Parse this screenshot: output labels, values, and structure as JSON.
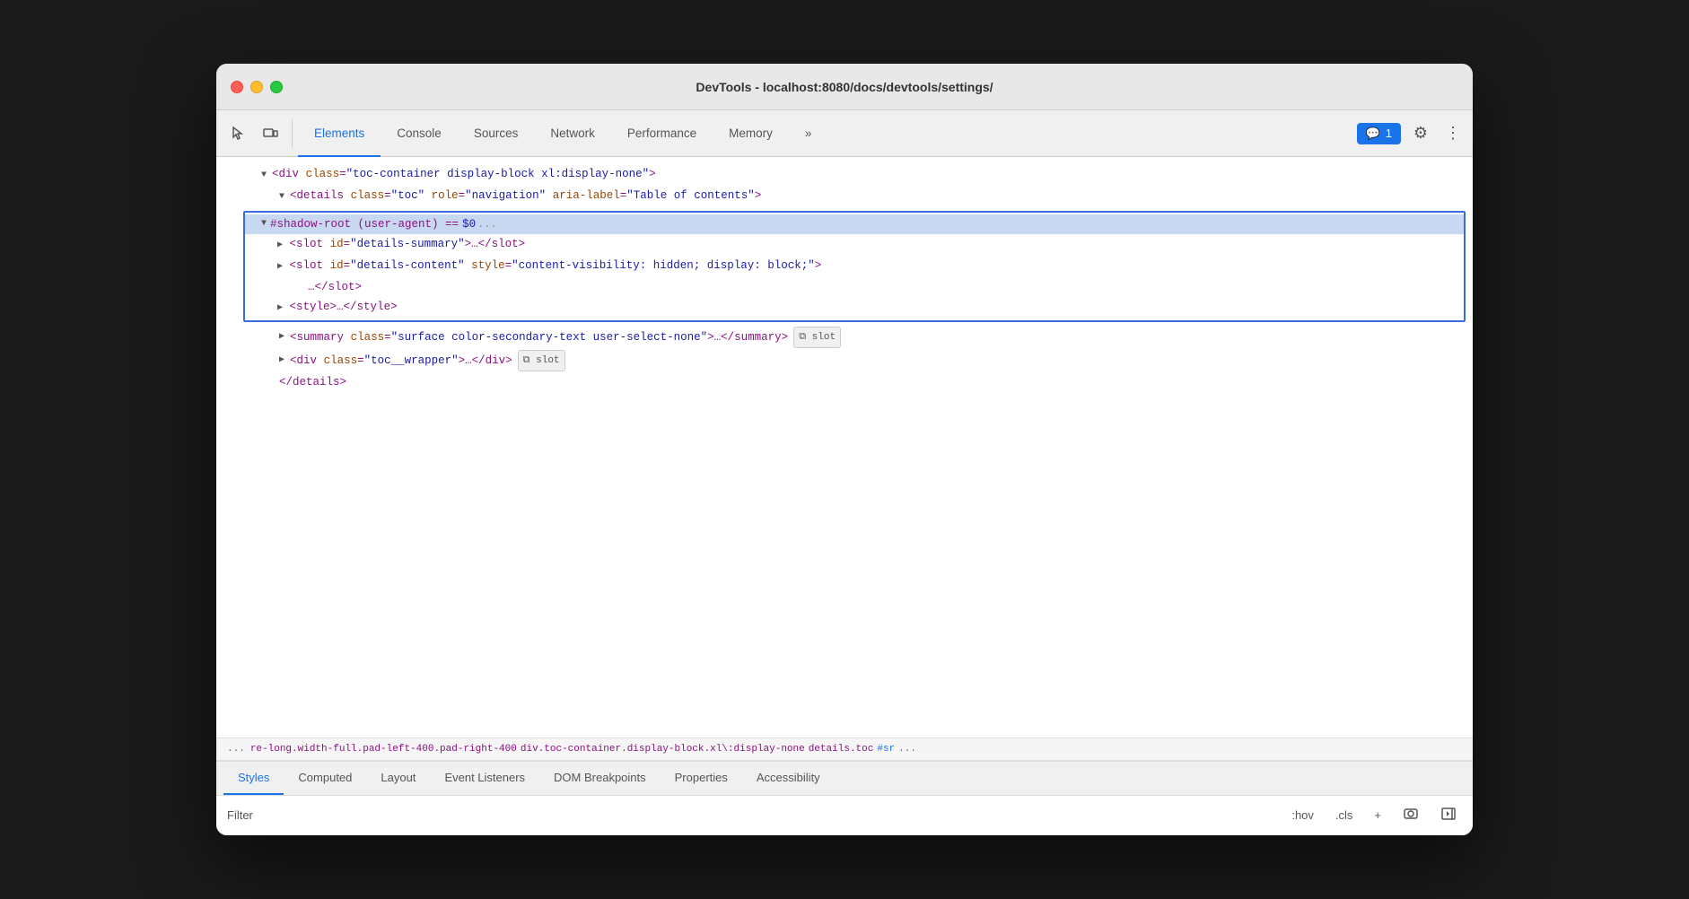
{
  "window": {
    "title": "DevTools - localhost:8080/docs/devtools/settings/"
  },
  "toolbar": {
    "tabs": [
      {
        "label": "Elements",
        "active": true
      },
      {
        "label": "Console",
        "active": false
      },
      {
        "label": "Sources",
        "active": false
      },
      {
        "label": "Network",
        "active": false
      },
      {
        "label": "Performance",
        "active": false
      },
      {
        "label": "Memory",
        "active": false
      },
      {
        "label": "»",
        "active": false
      }
    ],
    "msg_count": "1",
    "msg_icon": "💬"
  },
  "dom": {
    "line1": "▼ <div class=\"toc-container display-block xl:display-none\">",
    "line2": "▼ <details class=\"toc\" role=\"navigation\" aria-label=\"Table of contents\">",
    "shadow_root_label": "▼ #shadow-root (user-agent) == $0",
    "shadow_line1": "▶ <slot id=\"details-summary\">…</slot>",
    "shadow_line2": "▶ <slot id=\"details-content\" style=\"content-visibility: hidden; display: block;\">",
    "shadow_ellipsis": "…</slot>",
    "shadow_line3": "▶ <style>…</style>",
    "line3": "▶ <summary class=\"surface color-secondary-text user-select-none\">…</summary>",
    "slot_badge1": "⧉ slot",
    "line4": "▶ <div class=\"toc__wrapper\">…</div>",
    "slot_badge2": "⧉ slot",
    "line5": "</details>"
  },
  "breadcrumb": {
    "dots": "...",
    "items": [
      {
        "text": "re-long.width-full.pad-left-400.pad-right-400",
        "type": "class"
      },
      {
        "text": "div.toc-container.display-block.xl\\:display-none",
        "type": "element"
      },
      {
        "text": "details.toc",
        "type": "element"
      },
      {
        "text": "#sr",
        "type": "hash"
      },
      {
        "text": "...",
        "type": "dots"
      }
    ]
  },
  "bottom": {
    "tabs": [
      {
        "label": "Styles",
        "active": true
      },
      {
        "label": "Computed",
        "active": false
      },
      {
        "label": "Layout",
        "active": false
      },
      {
        "label": "Event Listeners",
        "active": false
      },
      {
        "label": "DOM Breakpoints",
        "active": false
      },
      {
        "label": "Properties",
        "active": false
      },
      {
        "label": "Accessibility",
        "active": false
      }
    ],
    "filter_label": "Filter",
    "filter_actions": [
      ":hov",
      ".cls",
      "+"
    ],
    "filter_icon1": "⧉",
    "filter_icon2": "←"
  }
}
